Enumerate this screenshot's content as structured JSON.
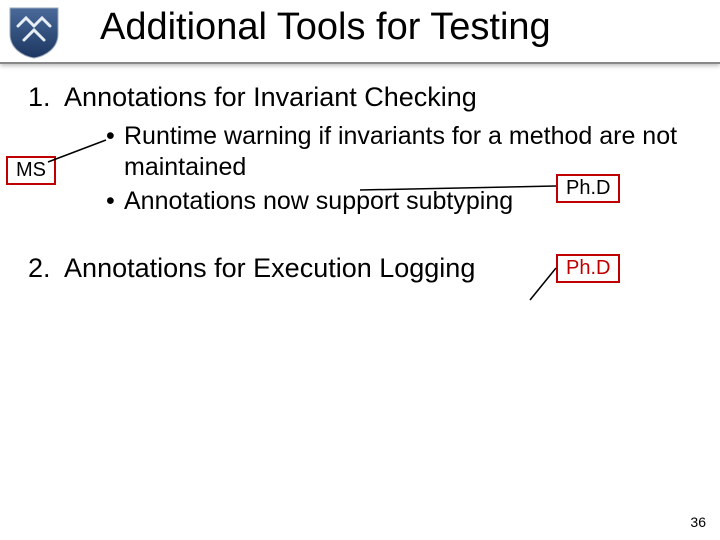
{
  "title": "Additional Tools for Testing",
  "sections": [
    {
      "number": "1.",
      "heading": "Annotations for Invariant Checking",
      "bullets": [
        "Runtime warning if invariants for a method are not maintained",
        "Annotations now support subtyping"
      ]
    },
    {
      "number": "2.",
      "heading": "Annotations for Execution Logging",
      "bullets": []
    }
  ],
  "tags": {
    "ms": "MS",
    "phd1": "Ph.D",
    "phd2": "Ph.D"
  },
  "page_number": "36"
}
